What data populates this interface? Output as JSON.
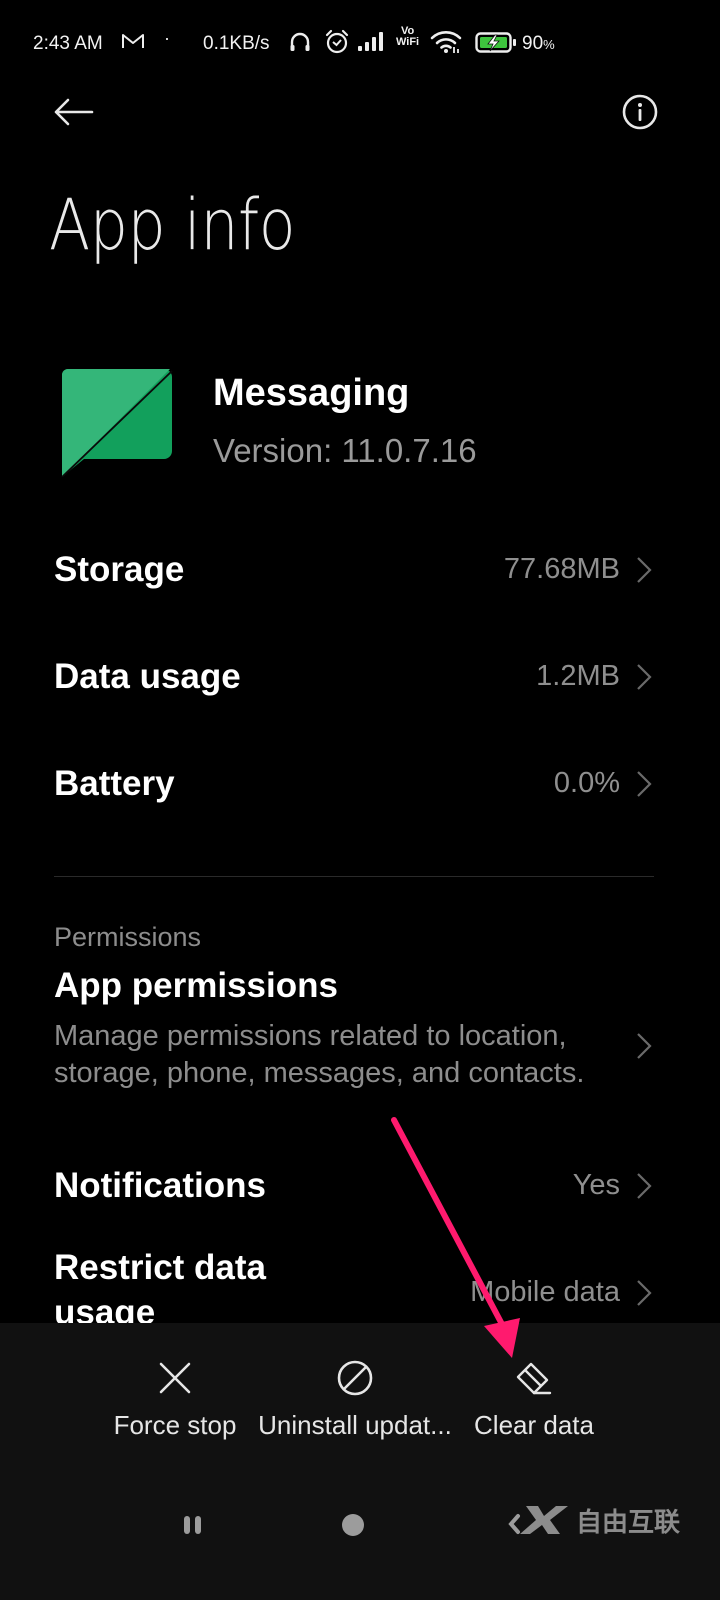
{
  "status_bar": {
    "time": "2:43 AM",
    "separator": "·",
    "network_speed": "0.1KB/s",
    "vowifi_top": "Vo",
    "vowifi_bottom": "WiFi",
    "battery_percent": "90",
    "battery_percent_sign": "%",
    "icons": [
      "gmail-icon",
      "headphones-icon",
      "alarm-icon",
      "signal-icon",
      "vowifi-icon",
      "wifi-icon",
      "battery-charging-icon"
    ]
  },
  "header": {
    "back_icon": "arrow-left-icon",
    "info_icon": "info-icon",
    "title": "App info"
  },
  "app": {
    "name": "Messaging",
    "version": "Version: 11.0.7.16",
    "icon_colors": {
      "light": "#34b679",
      "dark": "#12a05c"
    }
  },
  "rows": {
    "storage": {
      "label": "Storage",
      "value": "77.68MB"
    },
    "data_usage": {
      "label": "Data usage",
      "value": "1.2MB"
    },
    "battery": {
      "label": "Battery",
      "value": "0.0%"
    },
    "notifications": {
      "label": "Notifications",
      "value": "Yes"
    },
    "restrict_data": {
      "label_line1": "Restrict data",
      "label_line2": "usage",
      "value": "Mobile data"
    }
  },
  "permissions": {
    "section_header": "Permissions",
    "title": "App permissions",
    "description": "Manage permissions related to location, storage, phone, messages, and contacts."
  },
  "actions": [
    {
      "label": "Force stop",
      "icon": "close-icon"
    },
    {
      "label": "Uninstall updat...",
      "icon": "prohibited-icon"
    },
    {
      "label": "Clear data",
      "icon": "eraser-icon"
    }
  ],
  "nav_bar": {
    "items": [
      "recents-icon",
      "home-icon",
      "back-icon"
    ]
  },
  "watermark": {
    "text": "自由互联"
  },
  "annotation": {
    "color": "#ff1a6e",
    "target": "Clear data"
  }
}
